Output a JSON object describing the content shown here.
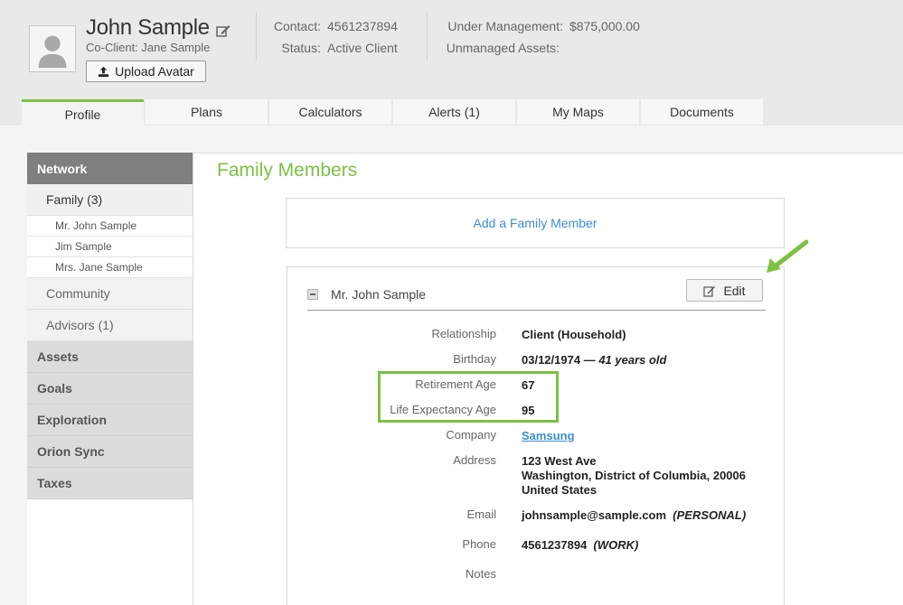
{
  "header": {
    "client_name": "John Sample",
    "coclient_label": "Co-Client:",
    "coclient_name": "Jane Sample",
    "upload_label": "Upload Avatar",
    "contact_label": "Contact:",
    "contact_value": "4561237894",
    "status_label": "Status:",
    "status_value": "Active Client",
    "under_mgmt_label": "Under Management:",
    "under_mgmt_value": "$875,000.00",
    "unmanaged_label": "Unmanaged Assets:",
    "unmanaged_value": ""
  },
  "tabs": [
    {
      "label": "Profile",
      "active": true
    },
    {
      "label": "Plans"
    },
    {
      "label": "Calculators"
    },
    {
      "label": "Alerts (1)"
    },
    {
      "label": "My Maps"
    },
    {
      "label": "Documents"
    }
  ],
  "sidebar": {
    "header": "Network",
    "family": "Family (3)",
    "family_members": [
      "Mr. John Sample",
      "Jim Sample",
      "Mrs. Jane Sample"
    ],
    "community": "Community",
    "advisors": "Advisors (1)",
    "sections": [
      "Assets",
      "Goals",
      "Exploration",
      "Orion Sync",
      "Taxes"
    ]
  },
  "main": {
    "title": "Family Members",
    "add_link": "Add a Family Member",
    "member": {
      "name": "Mr. John Sample",
      "edit_label": "Edit",
      "relationship_label": "Relationship",
      "relationship": "Client (Household)",
      "birthday_label": "Birthday",
      "birthday": "03/12/1974 —",
      "age": "41 years old",
      "retirement_label": "Retirement Age",
      "retirement": "67",
      "life_label": "Life Expectancy Age",
      "life": "95",
      "company_label": "Company",
      "company": "Samsung",
      "address_label": "Address",
      "address_line1": "123 West Ave",
      "address_line2": "Washington, District of Columbia, 20006",
      "address_line3": "United States",
      "email_label": "Email",
      "email": "johnsample@sample.com",
      "email_type": "(PERSONAL)",
      "phone_label": "Phone",
      "phone": "4561237894",
      "phone_type": "(WORK)",
      "notes_label": "Notes"
    }
  },
  "colors": {
    "accent_green": "#7dc142",
    "link_blue": "#3c8dd0",
    "sidebar_header": "#7f7f7f"
  }
}
